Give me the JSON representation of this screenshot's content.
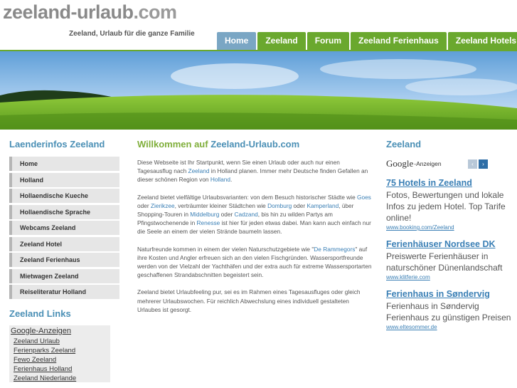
{
  "header": {
    "logo": "zeeland-urlaub",
    "logo_ext": ".com",
    "tagline": "Zeeland, Urlaub für die ganze Familie"
  },
  "nav": {
    "tabs": [
      {
        "label": "Home"
      },
      {
        "label": "Zeeland"
      },
      {
        "label": "Forum"
      },
      {
        "label": "Zeeland Ferienhaus"
      },
      {
        "label": "Zeeland Hotels"
      }
    ]
  },
  "left": {
    "title": "Laenderinfos Zeeland",
    "menu": [
      {
        "label": "Home"
      },
      {
        "label": "Holland"
      },
      {
        "label": "Hollaendische Kueche"
      },
      {
        "label": "Hollaendische Sprache"
      },
      {
        "label": "Webcams Zeeland"
      },
      {
        "label": "Zeeland Hotel"
      },
      {
        "label": "Zeeland Ferienhaus"
      },
      {
        "label": "Mietwagen Zeeland"
      },
      {
        "label": "Reiseliteratur Holland"
      }
    ],
    "links_title": "Zeeland Links",
    "ads_heading": "Google-Anzeigen",
    "ads": [
      {
        "label": "Zeeland Urlaub"
      },
      {
        "label": "Ferienparks Zeeland"
      },
      {
        "label": "Fewo Zeeland"
      },
      {
        "label": "Ferienhaus Holland"
      },
      {
        "label": "Zeeland Niederlande"
      }
    ]
  },
  "main": {
    "title_prefix": "Willkommen auf",
    "title_site": "Zeeland-Urlaub.com",
    "p1": {
      "t1": "Diese Webseite ist Ihr Startpunkt, wenn Sie einen Urlaub oder auch nur einen Tagesausflug nach ",
      "l1": "Zeeland",
      "t2": " in Holland planen. Immer mehr Deutsche finden Gefallen an dieser schönen Region von ",
      "l2": "Holland",
      "t3": "."
    },
    "p2": {
      "t1": "Zeeland bietet vielfältige Urlaubsvarianten: von dem Besuch historischer Städte wie ",
      "l1": "Goes",
      "t2": " oder ",
      "l2": "Zierikzee",
      "t3": ", verträumter kleiner Städtchen wie ",
      "l3": "Domburg",
      "t4": " oder ",
      "l4": "Kamperland",
      "t5": ", über Shopping-Touren in ",
      "l5": "Middelburg",
      "t6": " oder ",
      "l6": "Cadzand",
      "t7": ", bis hin zu wilden Partys am Pfingstwochenende in ",
      "l7": "Renesse",
      "t8": " ist hier für jeden etwas dabei. Man kann auch einfach nur die Seele an einem der vielen Strände baumeln lassen."
    },
    "p3": {
      "t1": "Naturfreunde kommen in einem der vielen Naturschutzgebiete wie \"",
      "l1": "De Rammegors",
      "t2": "\" auf ihre Kosten und Angler erfreuen sich an den vielen Fischgründen. Wassersportfreunde werden von der Vielzahl der Yachthäfen und der extra auch für extreme Wassersportarten geschaffenen Strandabschnitten begeistert sein."
    },
    "p4": "Zeeland bietet Urlaubfeeling pur, sei es im Rahmen eines Tagesausfluges oder gleich mehrerer Urlaubswochen. Für reichlich Abwechslung eines individuell gestalteten Urlaubes ist gesorgt."
  },
  "right": {
    "title": "Zeeland",
    "google_logo": "Google",
    "google_suffix": "-Anzeigen",
    "prev_icon": "‹",
    "next_icon": "›",
    "ads": [
      {
        "title": "75 Hotels in Zeeland",
        "text": "Fotos, Bewertungen und lokale Infos zu jedem Hotel. Top Tarife online!",
        "url": "www.booking.com/Zeeland"
      },
      {
        "title": "Ferienhäuser Nordsee DK",
        "text": "Preiswerte Ferienhäuser in naturschöner Dünenlandschaft",
        "url": "www.klitferie.com"
      },
      {
        "title": "Ferienhaus in Søndervig",
        "text": "Ferienhaus in Søndervig Ferienhaus zu günstigen Preisen",
        "url": "www.eltesommer.de"
      }
    ]
  },
  "colors": {
    "nav_green": "#6aa82e",
    "nav_active": "#7aa6c4",
    "link_blue": "#3a7fb5",
    "heading_green": "#7fae3a"
  }
}
